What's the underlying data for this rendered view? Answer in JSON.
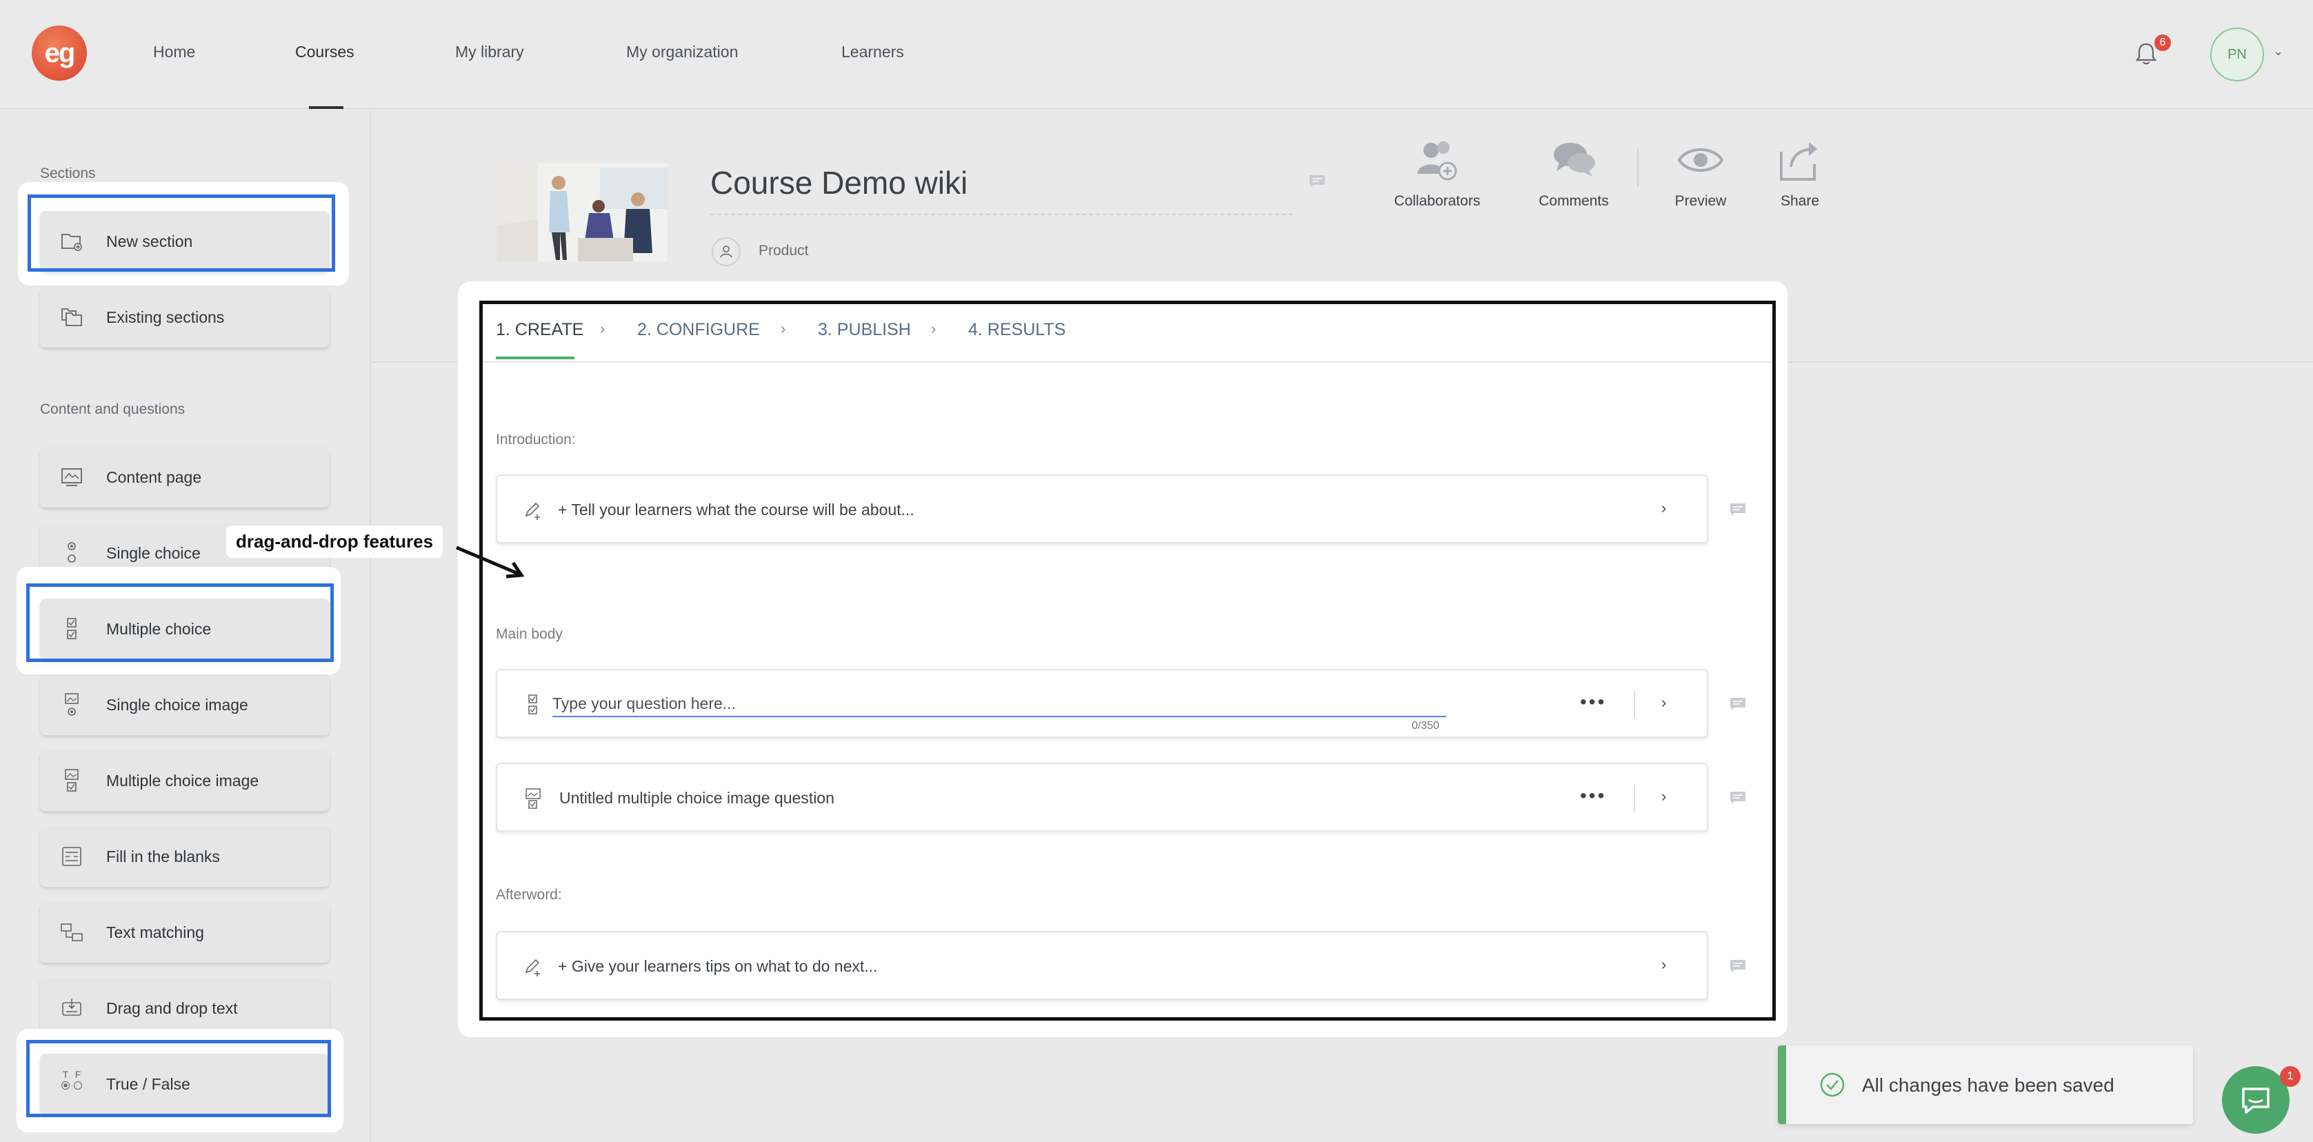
{
  "brand": {
    "logo_text": "eg"
  },
  "nav": {
    "items": [
      {
        "label": "Home",
        "active": false
      },
      {
        "label": "Courses",
        "active": true
      },
      {
        "label": "My library",
        "active": false
      },
      {
        "label": "My organization",
        "active": false
      },
      {
        "label": "Learners",
        "active": false
      }
    ]
  },
  "notifications": {
    "count": "6",
    "icon": "bell-icon"
  },
  "user": {
    "initials": "PN"
  },
  "sidebar": {
    "sections_title": "Sections",
    "sections": [
      {
        "label": "New section",
        "icon": "folder-plus-icon",
        "highlighted": true
      },
      {
        "label": "Existing sections",
        "icon": "folders-icon",
        "highlighted": false
      }
    ],
    "content_title": "Content and questions",
    "content": [
      {
        "label": "Content page",
        "icon": "content-page-icon",
        "highlighted": false
      },
      {
        "label": "Single choice",
        "icon": "single-choice-icon",
        "highlighted": false
      },
      {
        "label": "Multiple choice",
        "icon": "multiple-choice-icon",
        "highlighted": true
      },
      {
        "label": "Single choice image",
        "icon": "single-choice-image-icon",
        "highlighted": false
      },
      {
        "label": "Multiple choice image",
        "icon": "multiple-choice-image-icon",
        "highlighted": false
      },
      {
        "label": "Fill in the blanks",
        "icon": "fill-blanks-icon",
        "highlighted": false
      },
      {
        "label": "Text matching",
        "icon": "text-matching-icon",
        "highlighted": false
      },
      {
        "label": "Drag and drop text",
        "icon": "drag-drop-text-icon",
        "highlighted": false
      },
      {
        "label": "True / False",
        "icon": "true-false-icon",
        "highlighted": true
      }
    ],
    "tf_letters": {
      "t": "T",
      "f": "F"
    }
  },
  "course": {
    "title": "Course Demo wiki",
    "category": "Product"
  },
  "header_actions": [
    {
      "label": "Collaborators",
      "icon": "collaborators-icon"
    },
    {
      "label": "Comments",
      "icon": "comments-icon"
    },
    {
      "label": "Preview",
      "icon": "eye-icon"
    },
    {
      "label": "Share",
      "icon": "share-icon"
    }
  ],
  "steps": [
    {
      "label": "1. CREATE",
      "active": true
    },
    {
      "label": "2. CONFIGURE",
      "active": false
    },
    {
      "label": "3. PUBLISH",
      "active": false
    },
    {
      "label": "4. RESULTS",
      "active": false
    }
  ],
  "step_separator": "›",
  "editor": {
    "introduction_label": "Introduction:",
    "introduction_prompt": "+ Tell your learners what the course will be about...",
    "main_body_label": "Main body",
    "question_placeholder": "Type your question here...",
    "question_value": "",
    "question_counter": "0/350",
    "question_2": "Untitled multiple choice image question",
    "afterword_label": "Afterword:",
    "afterword_prompt": "+ Give your learners tips on what to do next...",
    "more_dots": "•••",
    "chevron": "›"
  },
  "annotation": {
    "text": "drag-and-drop features"
  },
  "toast": {
    "message": "All changes have been saved"
  },
  "chat": {
    "badge": "1"
  },
  "colors": {
    "accent_blue": "#2f6fde",
    "success_green": "#5fad6c",
    "logo_orange": "#e0553a",
    "badge_red": "#e24b43"
  }
}
